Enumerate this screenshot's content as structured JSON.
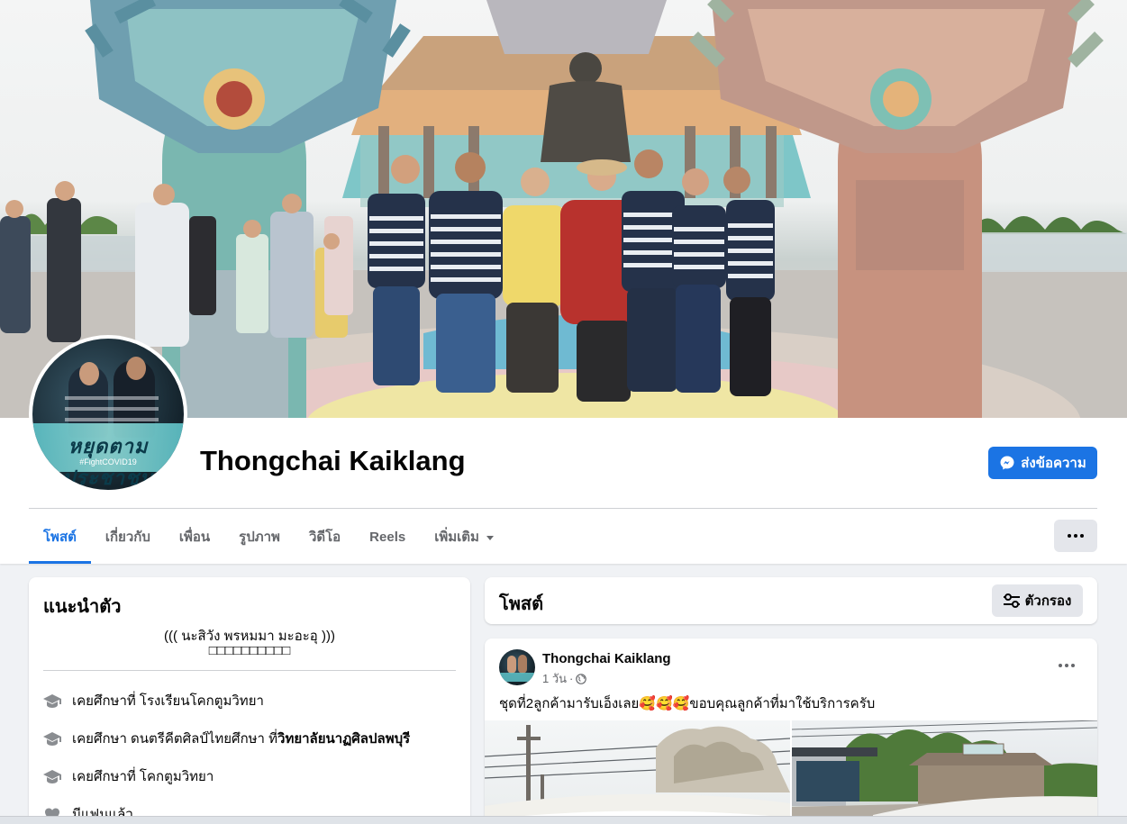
{
  "colors": {
    "accent": "#1b74e4",
    "page_background": "#f0f2f5",
    "card_background": "#ffffff",
    "secondary_text": "#65676b",
    "button_gray": "#e4e6eb"
  },
  "profile": {
    "name": "Thongchai Kaiklang",
    "avatar_text": "หยุดตามประชาชน",
    "avatar_subtext": "#FightCOVID19",
    "message_button": "ส่งข้อความ",
    "message_icon": "messenger-icon"
  },
  "tabs": [
    {
      "label": "โพสต์",
      "active": true
    },
    {
      "label": "เกี่ยวกับ",
      "active": false
    },
    {
      "label": "เพื่อน",
      "active": false
    },
    {
      "label": "รูปภาพ",
      "active": false
    },
    {
      "label": "วิดีโอ",
      "active": false
    },
    {
      "label": "Reels",
      "active": false
    },
    {
      "label": "เพิ่มเติม",
      "active": false,
      "icon": "caret-down-icon"
    }
  ],
  "intro": {
    "title": "แนะนำตัว",
    "bio_line1": "((( นะสิวัง พรหมมา มะอะอุ )))",
    "bio_line2": "□□□□□□□□□□",
    "items": [
      {
        "icon": "graduation-cap-icon",
        "text": "เคยศึกษาที่ โรงเรียนโคกตูมวิทยา",
        "bold": ""
      },
      {
        "icon": "graduation-cap-icon",
        "text": "เคยศึกษา ดนตรีคีตศิลป์ไทยศึกษา ที่ ",
        "bold": "วิทยาลัยนาฏศิลปลพบุรี"
      },
      {
        "icon": "graduation-cap-icon",
        "text": "เคยศึกษาที่ โคกตูมวิทยา",
        "bold": ""
      },
      {
        "icon": "heart-icon",
        "text": "มีแฟนแล้ว",
        "bold": ""
      }
    ]
  },
  "posts_section": {
    "title": "โพสต์",
    "filter_label": "ตัวกรอง",
    "filter_icon": "sliders-icon"
  },
  "post": {
    "author": "Thongchai Kaiklang",
    "time": "1 วัน",
    "separator": "·",
    "privacy_icon": "globe-icon",
    "text": "ชุดที่2ลูกค้ามารับเอ็งเลย🥰🥰🥰ขอบคุณลูกค้าที่มาใช้บริการครับ"
  }
}
